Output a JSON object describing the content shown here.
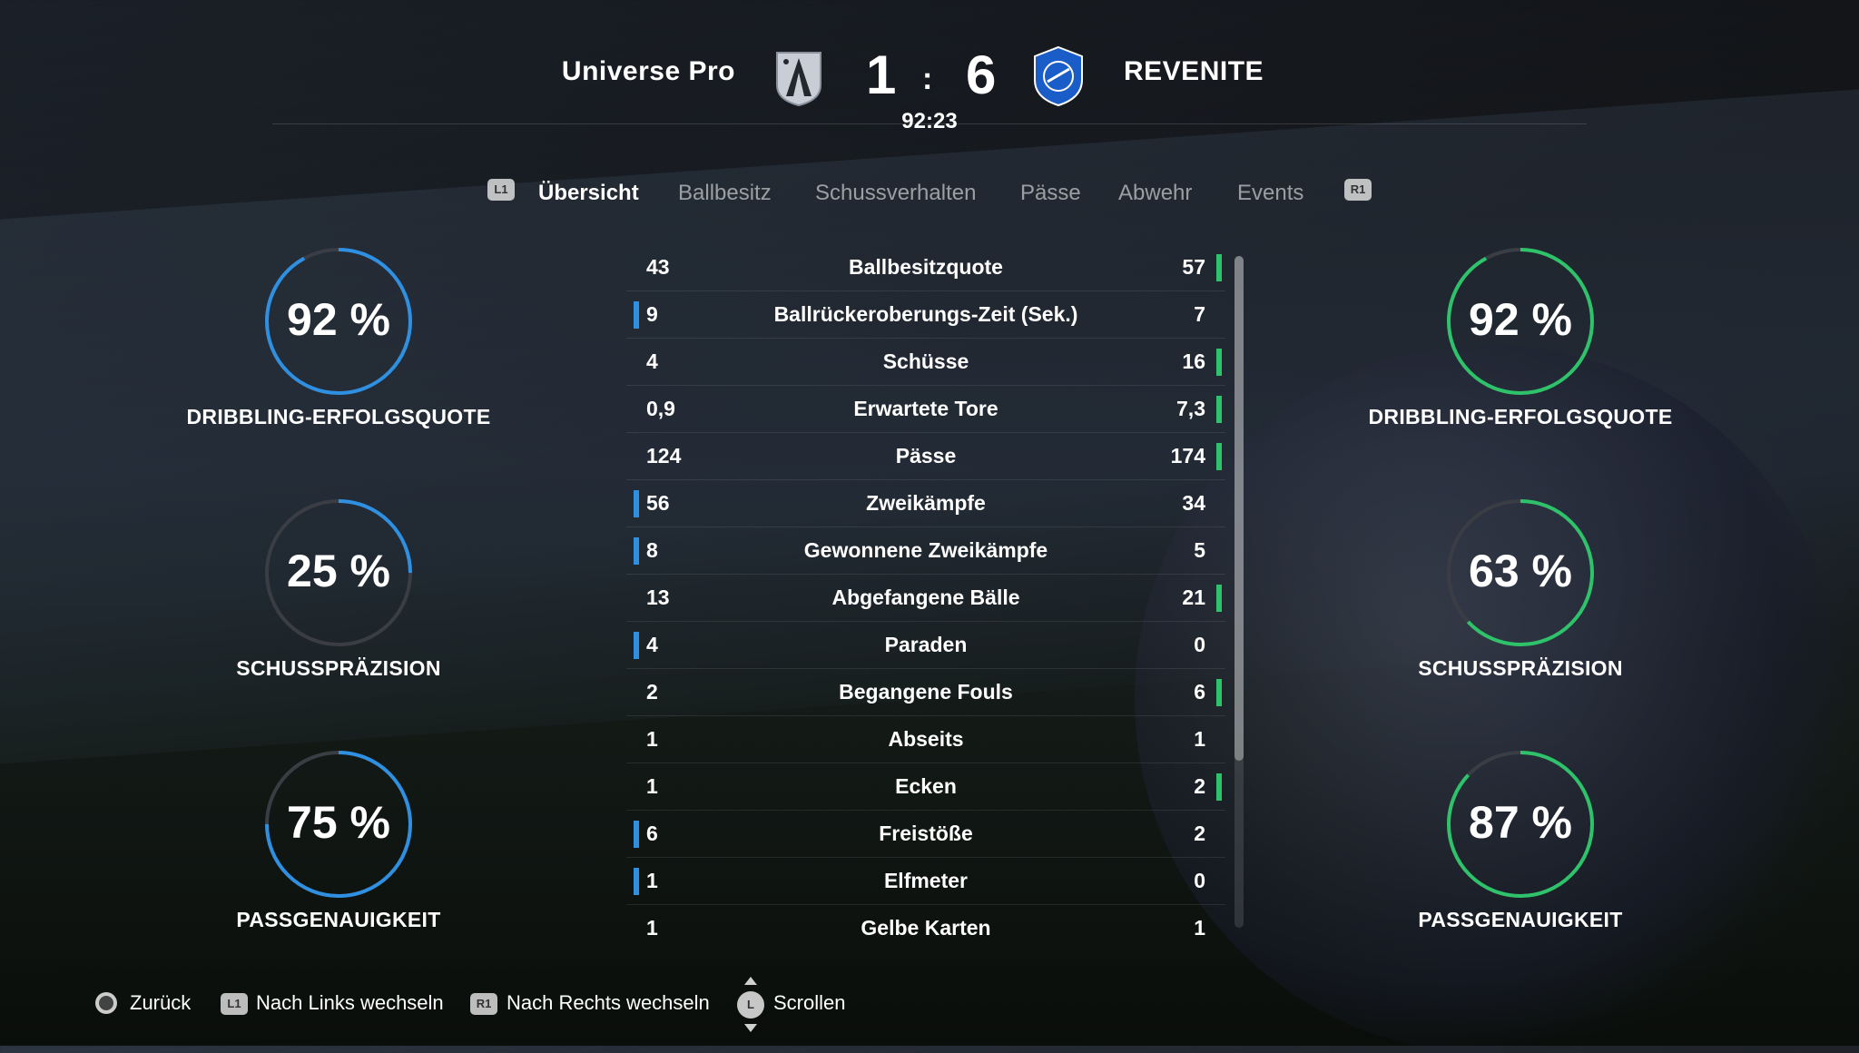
{
  "match": {
    "home_team": "Universe Pro",
    "away_team": "REVENITE",
    "home_score": "1",
    "separator": ":",
    "away_score": "6",
    "clock": "92:23"
  },
  "tabs": {
    "left_button": "L1",
    "right_button": "R1",
    "items": [
      {
        "label": "Übersicht",
        "active": true
      },
      {
        "label": "Ballbesitz",
        "active": false
      },
      {
        "label": "Schussverhalten",
        "active": false
      },
      {
        "label": "Pässe",
        "active": false
      },
      {
        "label": "Abwehr",
        "active": false
      },
      {
        "label": "Events",
        "active": false
      }
    ]
  },
  "home_rings": [
    {
      "value": "92 %",
      "label": "DRIBBLING-ERFOLGSQUOTE",
      "percent": 92
    },
    {
      "value": "25 %",
      "label": "SCHUSSPRÄZISION",
      "percent": 25
    },
    {
      "value": "75 %",
      "label": "PASSGENAUIGKEIT",
      "percent": 75
    }
  ],
  "away_rings": [
    {
      "value": "92 %",
      "label": "DRIBBLING-ERFOLGSQUOTE",
      "percent": 92
    },
    {
      "value": "63 %",
      "label": "SCHUSSPRÄZISION",
      "percent": 63
    },
    {
      "value": "87 %",
      "label": "PASSGENAUIGKEIT",
      "percent": 87
    }
  ],
  "stats": [
    {
      "home": "43",
      "name": "Ballbesitzquote",
      "away": "57",
      "leader": "away"
    },
    {
      "home": "9",
      "name": "Ballrückeroberungs-Zeit (Sek.)",
      "away": "7",
      "leader": "home"
    },
    {
      "home": "4",
      "name": "Schüsse",
      "away": "16",
      "leader": "away"
    },
    {
      "home": "0,9",
      "name": "Erwartete Tore",
      "away": "7,3",
      "leader": "away"
    },
    {
      "home": "124",
      "name": "Pässe",
      "away": "174",
      "leader": "away"
    },
    {
      "home": "56",
      "name": "Zweikämpfe",
      "away": "34",
      "leader": "home"
    },
    {
      "home": "8",
      "name": "Gewonnene Zweikämpfe",
      "away": "5",
      "leader": "home"
    },
    {
      "home": "13",
      "name": "Abgefangene Bälle",
      "away": "21",
      "leader": "away"
    },
    {
      "home": "4",
      "name": "Paraden",
      "away": "0",
      "leader": "home"
    },
    {
      "home": "2",
      "name": "Begangene Fouls",
      "away": "6",
      "leader": "away"
    },
    {
      "home": "1",
      "name": "Abseits",
      "away": "1",
      "leader": "none"
    },
    {
      "home": "1",
      "name": "Ecken",
      "away": "2",
      "leader": "away"
    },
    {
      "home": "6",
      "name": "Freistöße",
      "away": "2",
      "leader": "home"
    },
    {
      "home": "1",
      "name": "Elfmeter",
      "away": "0",
      "leader": "home"
    },
    {
      "home": "1",
      "name": "Gelbe Karten",
      "away": "1",
      "leader": "none"
    }
  ],
  "footer": {
    "back": "Zurück",
    "switch_left_button": "L1",
    "switch_left": "Nach Links wechseln",
    "switch_right_button": "R1",
    "switch_right": "Nach Rechts wechseln",
    "scroll_button": "L",
    "scroll": "Scrollen"
  },
  "colors": {
    "home_accent": "#2f8fe0",
    "away_accent": "#2ec36a",
    "ring_track": "#3a3d44"
  }
}
